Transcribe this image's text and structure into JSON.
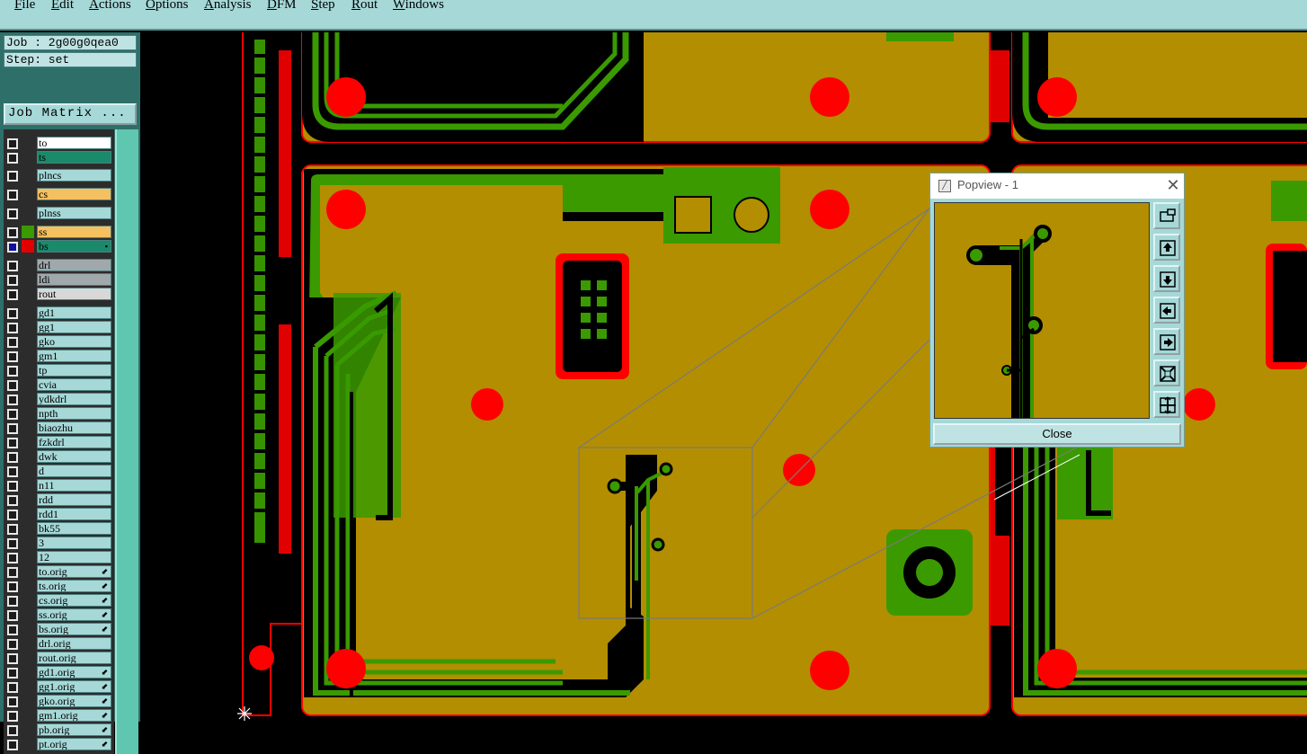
{
  "menu": {
    "items": [
      {
        "label": "File",
        "underline": "F",
        "rest": "ile"
      },
      {
        "label": "Edit",
        "underline": "E",
        "rest": "dit"
      },
      {
        "label": "Actions",
        "underline": "A",
        "rest": "ctions"
      },
      {
        "label": "Options",
        "underline": "O",
        "rest": "ptions"
      },
      {
        "label": "Analysis",
        "underline": "A",
        "rest": "nalysis"
      },
      {
        "label": "DFM",
        "underline": "D",
        "rest": "FM"
      },
      {
        "label": "Step",
        "underline": "S",
        "rest": "tep"
      },
      {
        "label": "Rout",
        "underline": "R",
        "rest": "out"
      },
      {
        "label": "Windows",
        "underline": "W",
        "rest": "indows"
      }
    ]
  },
  "job": {
    "label": "Job : 2g00g0qea0"
  },
  "step": {
    "label": "Step: set"
  },
  "job_matrix_label": "Job Matrix ...",
  "layers": [
    {
      "name": "to",
      "color": "#ffffff",
      "checked": false,
      "mark": ""
    },
    {
      "name": "ts",
      "color": "#1a8a6a",
      "checked": false,
      "mark": ""
    },
    {
      "name": "plncs",
      "color": "",
      "checked": false,
      "mark": ""
    },
    {
      "name": "cs",
      "color": "#f5c060",
      "checked": false,
      "mark": ""
    },
    {
      "name": "plnss",
      "color": "",
      "checked": false,
      "mark": ""
    },
    {
      "name": "ss",
      "color": "#f5c060",
      "checked": false,
      "mark": "",
      "swatch": "#3a9a00"
    },
    {
      "name": "bs",
      "color": "#1a8a6a",
      "checked": true,
      "mark": "▪",
      "swatch": "#e00000"
    },
    {
      "name": "drl",
      "color": "#a0a8ac",
      "checked": false,
      "mark": ""
    },
    {
      "name": "ldi",
      "color": "#a0a8ac",
      "checked": false,
      "mark": ""
    },
    {
      "name": "rout",
      "color": "#d8d8d8",
      "checked": false,
      "mark": ""
    },
    {
      "name": "gd1",
      "color": "",
      "checked": false,
      "mark": ""
    },
    {
      "name": "gg1",
      "color": "",
      "checked": false,
      "mark": ""
    },
    {
      "name": "gko",
      "color": "",
      "checked": false,
      "mark": ""
    },
    {
      "name": "gm1",
      "color": "",
      "checked": false,
      "mark": ""
    },
    {
      "name": "tp",
      "color": "",
      "checked": false,
      "mark": ""
    },
    {
      "name": "cvia",
      "color": "",
      "checked": false,
      "mark": ""
    },
    {
      "name": "ydkdrl",
      "color": "",
      "checked": false,
      "mark": ""
    },
    {
      "name": "npth",
      "color": "",
      "checked": false,
      "mark": ""
    },
    {
      "name": "biaozhu",
      "color": "",
      "checked": false,
      "mark": ""
    },
    {
      "name": "fzkdrl",
      "color": "",
      "checked": false,
      "mark": ""
    },
    {
      "name": "dwk",
      "color": "",
      "checked": false,
      "mark": ""
    },
    {
      "name": "d",
      "color": "",
      "checked": false,
      "mark": ""
    },
    {
      "name": "n11",
      "color": "",
      "checked": false,
      "mark": ""
    },
    {
      "name": "rdd",
      "color": "",
      "checked": false,
      "mark": ""
    },
    {
      "name": "rdd1",
      "color": "",
      "checked": false,
      "mark": ""
    },
    {
      "name": "bk55",
      "color": "",
      "checked": false,
      "mark": ""
    },
    {
      "name": "3",
      "color": "",
      "checked": false,
      "mark": ""
    },
    {
      "name": "12",
      "color": "",
      "checked": false,
      "mark": ""
    },
    {
      "name": "to.orig",
      "color": "",
      "checked": false,
      "mark": "⬋"
    },
    {
      "name": "ts.orig",
      "color": "",
      "checked": false,
      "mark": "⬋"
    },
    {
      "name": "cs.orig",
      "color": "",
      "checked": false,
      "mark": "⬋"
    },
    {
      "name": "ss.orig",
      "color": "",
      "checked": false,
      "mark": "⬋"
    },
    {
      "name": "bs.orig",
      "color": "",
      "checked": false,
      "mark": "⬋"
    },
    {
      "name": "drl.orig",
      "color": "",
      "checked": false,
      "mark": ""
    },
    {
      "name": "rout.orig",
      "color": "",
      "checked": false,
      "mark": ""
    },
    {
      "name": "gd1.orig",
      "color": "",
      "checked": false,
      "mark": "⬋"
    },
    {
      "name": "gg1.orig",
      "color": "",
      "checked": false,
      "mark": "⬋"
    },
    {
      "name": "gko.orig",
      "color": "",
      "checked": false,
      "mark": "⬋"
    },
    {
      "name": "gm1.orig",
      "color": "",
      "checked": false,
      "mark": "⬋"
    },
    {
      "name": "pb.orig",
      "color": "",
      "checked": false,
      "mark": "⬋"
    },
    {
      "name": "pt.orig",
      "color": "",
      "checked": false,
      "mark": "⬋"
    }
  ],
  "popview": {
    "title": "Popview - 1",
    "close_label": "Close",
    "buttons": [
      "zoom-fit-icon",
      "pan-up-icon",
      "pan-down-icon",
      "pan-left-icon",
      "pan-right-icon",
      "zoom-out-icon",
      "zoom-in-icon"
    ]
  },
  "colors": {
    "board_fill": "#b38e00",
    "copper": "#3a9a00",
    "outline": "#ff0000",
    "menu_bg": "#a6d8d8"
  }
}
